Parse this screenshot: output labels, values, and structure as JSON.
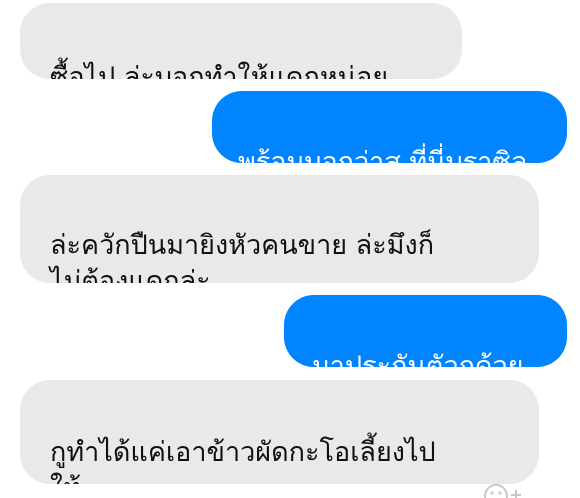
{
  "messages": [
    {
      "id": "b1",
      "sender": "other",
      "text": "ซื้อไป ล่ะบอกทำให้แดกหน่อย"
    },
    {
      "id": "b2",
      "sender": "me",
      "text": "พร้อมบอกว่าส ที่นี่บราซิล"
    },
    {
      "id": "b3",
      "sender": "other",
      "text": "ล่ะควักปืนมายิงหัวคนขาย ล่ะมึงก็\nไม่ต้องแดกล่ะ"
    },
    {
      "id": "b4",
      "sender": "me",
      "text": "มาประกันตัวกูด้วย"
    },
    {
      "id": "b5",
      "sender": "other",
      "text": "กูทำได้แค่เอาข้าวผัดกะโอเลี้ยงไป\nให้..."
    }
  ],
  "colors": {
    "incoming_bubble": "#e9e9eb",
    "outgoing_bubble": "#0084ff",
    "incoming_text": "#111111",
    "outgoing_text": "#ffffff"
  },
  "icons": {
    "reaction": "add-reaction-icon"
  }
}
